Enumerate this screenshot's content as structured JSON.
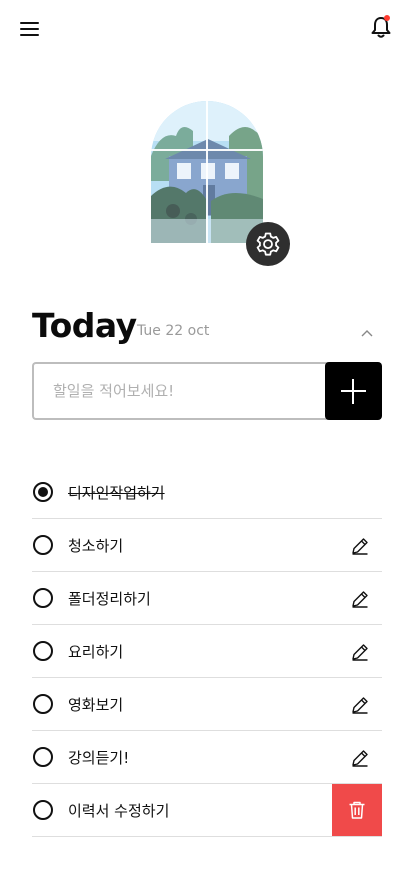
{
  "header": {
    "menu_icon": "hamburger-menu-icon",
    "notification_icon": "bell-icon",
    "notification_dot_color": "#ff3b30"
  },
  "profile": {
    "photo": "house-exterior-photo",
    "settings_icon": "gear-icon"
  },
  "today": {
    "title": "Today",
    "date": "Tue 22 oct",
    "collapse_icon": "chevron-up-icon"
  },
  "new_task": {
    "placeholder": "할일을 적어보세요!",
    "value": "",
    "add_icon": "plus-icon"
  },
  "tasks": [
    {
      "label": "디자인작업하기",
      "done": true,
      "action": "none"
    },
    {
      "label": "청소하기",
      "done": false,
      "action": "edit"
    },
    {
      "label": "폴더정리하기",
      "done": false,
      "action": "edit"
    },
    {
      "label": "요리하기",
      "done": false,
      "action": "edit"
    },
    {
      "label": "영화보기",
      "done": false,
      "action": "edit"
    },
    {
      "label": "강의듣기!",
      "done": false,
      "action": "edit"
    },
    {
      "label": "이력서 수정하기",
      "done": false,
      "action": "delete"
    }
  ],
  "colors": {
    "accent": "#000000",
    "delete": "#f04a4a",
    "date_text": "#9a9a9a",
    "divider": "#dedede"
  }
}
